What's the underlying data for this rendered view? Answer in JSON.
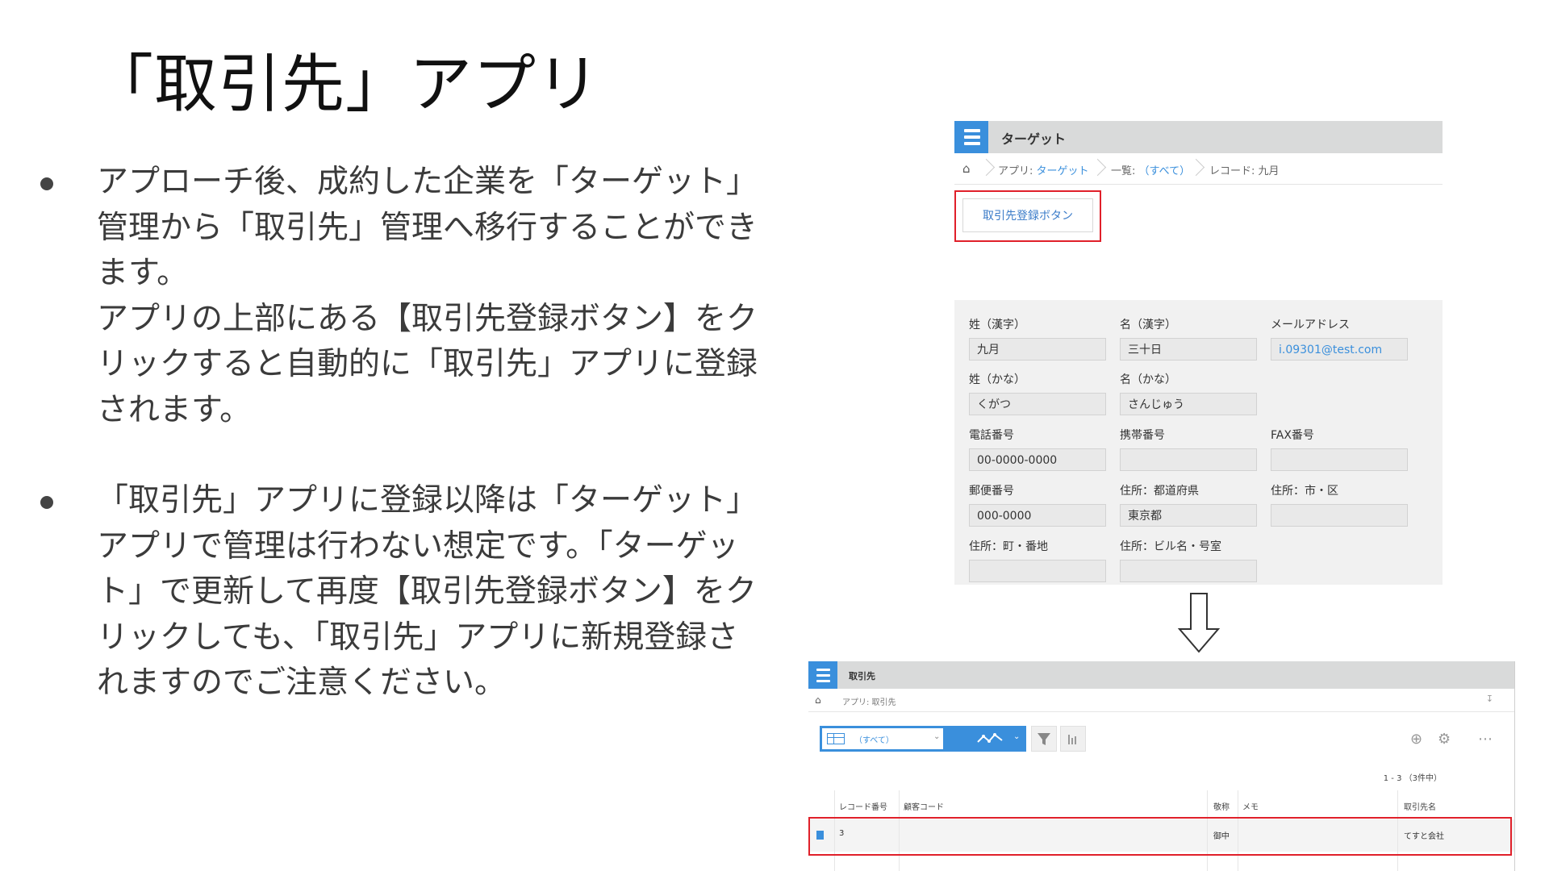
{
  "slide": {
    "title": "「取引先」アプリ",
    "bullets": [
      {
        "lines": [
          "アプローチ後、成約した企業を「ターゲット」",
          "管理から「取引先」管理へ移行することができ",
          "ます。",
          "アプリの上部にある【取引先登録ボタン】をク",
          "リックすると自動的に「取引先」アプリに登録",
          "されます。"
        ]
      },
      {
        "lines": [
          "「取引先」アプリに登録以降は「ターゲット」",
          "アプリで管理は行わない想定です。「ターゲッ",
          "ト」で更新して再度【取引先登録ボタン】をク",
          "リックしても、「取引先」アプリに新規登録さ",
          "れますのでご注意ください。"
        ]
      }
    ]
  },
  "target_app": {
    "app_name": "ターゲット",
    "breadcrumb": {
      "app_prefix": "アプリ: ",
      "app_link": "ターゲット",
      "list_prefix": "一覧: ",
      "list_link": "（すべて）",
      "record": "レコード: 九月"
    },
    "register_button": "取引先登録ボタン",
    "fields": [
      {
        "label": "姓（漢字）",
        "value": "九月"
      },
      {
        "label": "名（漢字）",
        "value": "三十日"
      },
      {
        "label": "メールアドレス",
        "value": "i.09301@test.com"
      },
      {
        "label": "姓（かな）",
        "value": "くがつ"
      },
      {
        "label": "名（かな）",
        "value": "さんじゅう"
      },
      {
        "label": "電話番号",
        "value": "00-0000-0000"
      },
      {
        "label": "携帯番号",
        "value": ""
      },
      {
        "label": "FAX番号",
        "value": ""
      },
      {
        "label": "郵便番号",
        "value": "000-0000"
      },
      {
        "label": "住所：都道府県",
        "value": "東京都"
      },
      {
        "label": "住所：市・区",
        "value": ""
      },
      {
        "label": "住所：町・番地",
        "value": ""
      },
      {
        "label": "住所：ビル名・号室",
        "value": ""
      }
    ]
  },
  "arrow": {
    "icon": "down-arrow-icon"
  },
  "torihiki_app": {
    "app_name": "取引先",
    "breadcrumb": "アプリ: 取引先",
    "view_select": "（すべて）",
    "count": "1 - 3 （3件中）",
    "columns": [
      "レコード番号",
      "顧客コード",
      "敬称",
      "メモ",
      "取引先名"
    ],
    "rows": [
      {
        "record_no": "3",
        "customer_code": "",
        "honorific": "御中",
        "memo": "",
        "company": "てすと会社"
      }
    ],
    "icons": [
      "add-icon",
      "gear-icon",
      "more-icon",
      "filter-icon",
      "graph-icon"
    ]
  },
  "colors": {
    "accent": "#3a8fdc",
    "highlight": "#e0202a",
    "header_gray": "#d9dada"
  }
}
